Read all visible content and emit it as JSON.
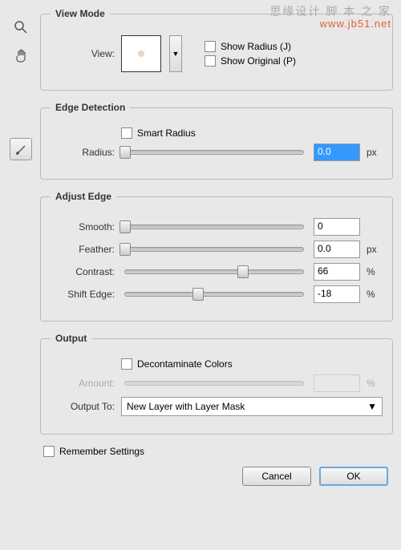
{
  "watermark": {
    "line1": "思缘设计 脚 本 之 家",
    "line2": "www.jb51.net"
  },
  "viewMode": {
    "legend": "View Mode",
    "viewLabel": "View:",
    "showRadius": "Show Radius (J)",
    "showOriginal": "Show Original (P)"
  },
  "edge": {
    "legend": "Edge Detection",
    "smart": "Smart Radius",
    "radiusLabel": "Radius:",
    "radiusVal": "0.0",
    "unit": "px"
  },
  "adjust": {
    "legend": "Adjust Edge",
    "smoothLabel": "Smooth:",
    "smoothVal": "0",
    "featherLabel": "Feather:",
    "featherVal": "0.0",
    "featherUnit": "px",
    "contrastLabel": "Contrast:",
    "contrastVal": "66",
    "contrastUnit": "%",
    "shiftLabel": "Shift Edge:",
    "shiftVal": "-18",
    "shiftUnit": "%"
  },
  "output": {
    "legend": "Output",
    "decon": "Decontaminate Colors",
    "amountLabel": "Amount:",
    "amountUnit": "%",
    "toLabel": "Output To:",
    "toVal": "New Layer with Layer Mask"
  },
  "remember": "Remember Settings",
  "cancel": "Cancel",
  "ok": "OK"
}
